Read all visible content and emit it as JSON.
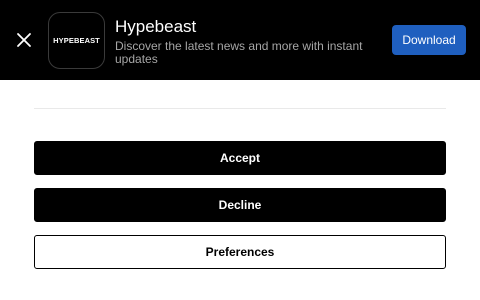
{
  "app_banner": {
    "close_icon": "close-icon",
    "app_icon_text": "HYPEBEAST",
    "app_name": "Hypebeast",
    "app_description": "Discover the latest news and more with instant updates",
    "download_label": "Download",
    "colors": {
      "background": "#000000",
      "download_button": "#1f5fbf",
      "description_text": "#a6a6a6"
    }
  },
  "consent": {
    "accept_label": "Accept",
    "decline_label": "Decline",
    "preferences_label": "Preferences"
  }
}
